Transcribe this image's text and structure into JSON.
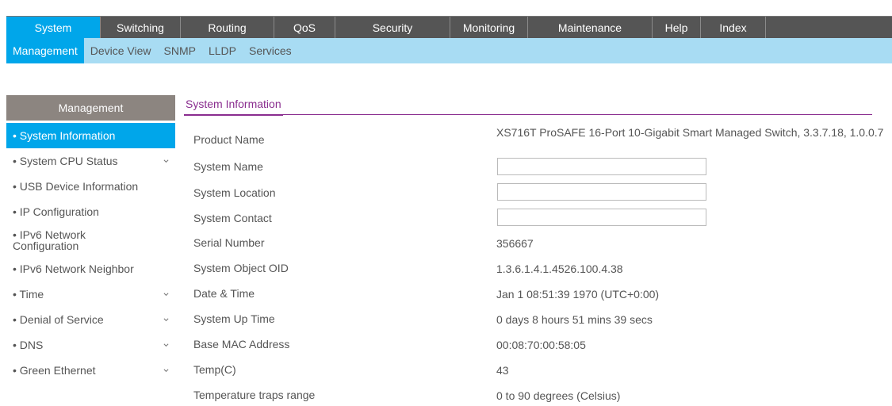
{
  "topnav": [
    "System",
    "Switching",
    "Routing",
    "QoS",
    "Security",
    "Monitoring",
    "Maintenance",
    "Help",
    "Index"
  ],
  "subnav": [
    "Management",
    "Device View",
    "SNMP",
    "LLDP",
    "Services"
  ],
  "sidebar": {
    "header": "Management",
    "items": [
      {
        "label": "System Information",
        "active": true,
        "expandable": false
      },
      {
        "label": "System CPU Status",
        "active": false,
        "expandable": true
      },
      {
        "label": "USB Device Information",
        "active": false,
        "expandable": false
      },
      {
        "label": "IP Configuration",
        "active": false,
        "expandable": false
      },
      {
        "label": "IPv6 Network Configuration",
        "active": false,
        "expandable": false
      },
      {
        "label": "IPv6 Network Neighbor",
        "active": false,
        "expandable": false
      },
      {
        "label": "Time",
        "active": false,
        "expandable": true
      },
      {
        "label": "Denial of Service",
        "active": false,
        "expandable": true
      },
      {
        "label": "DNS",
        "active": false,
        "expandable": true
      },
      {
        "label": "Green Ethernet",
        "active": false,
        "expandable": true
      }
    ]
  },
  "main": {
    "section_title": "System Information",
    "fields": {
      "product_name": {
        "label": "Product Name",
        "value": "XS716T ProSAFE 16-Port 10-Gigabit Smart Managed Switch, 3.3.7.18, 1.0.0.7"
      },
      "system_name": {
        "label": "System Name",
        "value": ""
      },
      "system_location": {
        "label": "System Location",
        "value": ""
      },
      "system_contact": {
        "label": "System Contact",
        "value": ""
      },
      "serial_number": {
        "label": "Serial Number",
        "value": "356667"
      },
      "system_object_oid": {
        "label": "System Object OID",
        "value": "1.3.6.1.4.1.4526.100.4.38"
      },
      "date_time": {
        "label": "Date & Time",
        "value": "Jan 1 08:51:39 1970 (UTC+0:00)"
      },
      "system_up_time": {
        "label": "System Up Time",
        "value": "0 days 8 hours 51 mins 39 secs"
      },
      "base_mac": {
        "label": "Base MAC Address",
        "value": "00:08:70:00:58:05"
      },
      "temp": {
        "label": "Temp(C)",
        "value": "43"
      },
      "temp_traps": {
        "label": "Temperature traps range",
        "value": "0 to 90 degrees (Celsius)"
      }
    }
  },
  "colors": {
    "accent": "#00a6ea",
    "topnav_bg": "#555555",
    "subnav_bg": "#a8dcf3",
    "section_title": "#8a2d8f"
  }
}
